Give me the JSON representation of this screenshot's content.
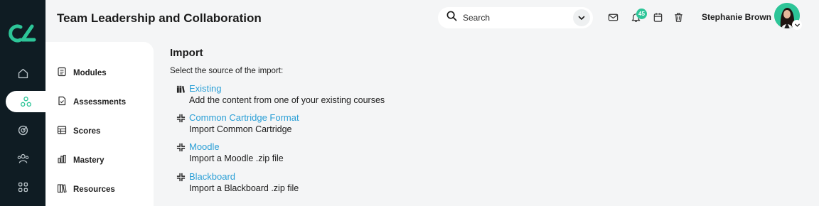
{
  "header": {
    "title": "Team Leadership and Collaboration",
    "search_placeholder": "Search",
    "notification_count": "45",
    "user_name": "Stephanie Brown"
  },
  "colors": {
    "rail_bg": "#0f1c23",
    "accent_green": "#2dc598",
    "link_blue": "#2a9fd6"
  },
  "rail": {
    "icons": [
      "logo-icon",
      "home-icon",
      "network-icon",
      "target-icon",
      "people-icon",
      "apps-grid-icon"
    ],
    "active": "network-icon"
  },
  "subnav": {
    "items": [
      {
        "label": "Modules",
        "icon": "modules-icon"
      },
      {
        "label": "Assessments",
        "icon": "assessments-icon"
      },
      {
        "label": "Scores",
        "icon": "scores-table-icon"
      },
      {
        "label": "Mastery",
        "icon": "bar-chart-icon"
      },
      {
        "label": "Resources",
        "icon": "books-icon"
      }
    ]
  },
  "main": {
    "title": "Import",
    "subtitle": "Select the source of the import:",
    "options": [
      {
        "label": "Existing",
        "description": "Add the content from one of your existing courses",
        "icon": "books-icon"
      },
      {
        "label": "Common Cartridge Format",
        "description": "Import Common Cartridge",
        "icon": "collapse-arrows-icon"
      },
      {
        "label": "Moodle",
        "description": "Import a Moodle .zip file",
        "icon": "collapse-arrows-icon"
      },
      {
        "label": "Blackboard",
        "description": "Import a Blackboard .zip file",
        "icon": "collapse-arrows-icon"
      }
    ]
  }
}
